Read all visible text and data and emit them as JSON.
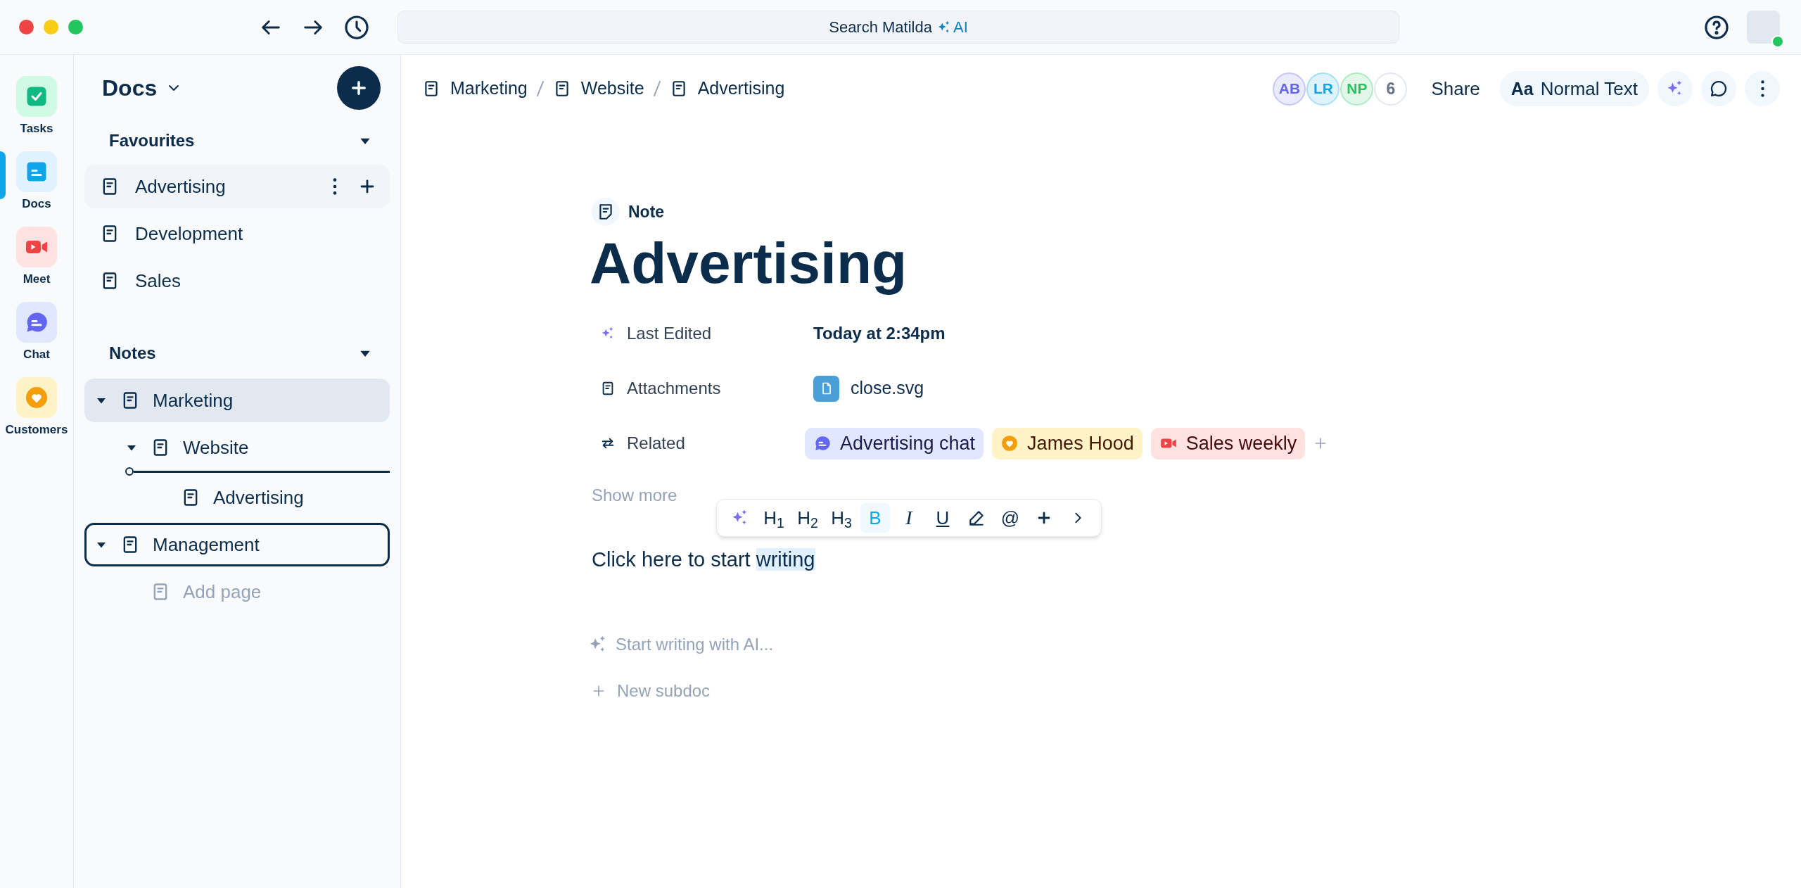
{
  "top_bar": {
    "search": {
      "text": "Search Matilda",
      "badge": "AI"
    }
  },
  "rail": [
    {
      "label": "Tasks",
      "kind": "tasks",
      "selected": false
    },
    {
      "label": "Docs",
      "kind": "docs",
      "selected": true
    },
    {
      "label": "Meet",
      "kind": "meet",
      "selected": false
    },
    {
      "label": "Chat",
      "kind": "chat",
      "selected": false
    },
    {
      "label": "Customers",
      "kind": "customers",
      "selected": false
    }
  ],
  "sidebar": {
    "title": "Docs",
    "favourites": {
      "title": "Favourites",
      "expanded": true,
      "items": [
        {
          "label": "Advertising",
          "hovered": true
        },
        {
          "label": "Development",
          "hovered": false
        },
        {
          "label": "Sales",
          "hovered": false
        }
      ]
    },
    "notes": {
      "title": "Notes",
      "expanded": true,
      "items": [
        {
          "label": "Marketing",
          "kind": "page",
          "selected": true,
          "focused": false,
          "expanded": true,
          "children": [
            {
              "label": "Website",
              "kind": "page",
              "selected": false,
              "focused": false,
              "expanded": true,
              "children": [
                {
                  "label": "Advertising",
                  "kind": "page",
                  "selected": false,
                  "focused": false,
                  "drop_target": true
                }
              ]
            }
          ]
        },
        {
          "label": "Management",
          "kind": "page",
          "selected": false,
          "focused": true,
          "expanded": true,
          "children": [
            {
              "label": "Add page",
              "kind": "add",
              "selected": false,
              "focused": false
            }
          ]
        }
      ]
    }
  },
  "header": {
    "breadcrumb": [
      "Marketing",
      "Website",
      "Advertising"
    ],
    "collaborators": [
      {
        "initials": "AB",
        "color": "#6366f1"
      },
      {
        "initials": "LR",
        "color": "#0ea5e9"
      },
      {
        "initials": "NP",
        "color": "#22c55e"
      }
    ],
    "more_count": "6",
    "share": "Share",
    "text_style_icon": "Aa",
    "text_style": "Normal Text"
  },
  "doc": {
    "type_label": "Note",
    "title": "Advertising",
    "properties": [
      {
        "label": "Last Edited",
        "kind": "date",
        "value": "Today at 2:34pm"
      },
      {
        "label": "Attachments",
        "kind": "attachment",
        "value": "close.svg"
      },
      {
        "label": "Related",
        "kind": "related",
        "chips": [
          {
            "label": "Advertising chat",
            "kind": "chat",
            "color": "#6366f1"
          },
          {
            "label": "James Hood",
            "kind": "customer",
            "color": "#f59e0b"
          },
          {
            "label": "Sales weekly",
            "kind": "meeting",
            "color": "#ef4444"
          }
        ]
      }
    ],
    "show_more": "Show more",
    "toolbar": [
      {
        "kind": "ai",
        "active": false
      },
      {
        "kind": "text",
        "label": "H$_{1}$",
        "active": false
      },
      {
        "kind": "text",
        "label": "H$_{2}$",
        "active": false
      },
      {
        "kind": "text",
        "label": "H$_{3}$",
        "active": false
      },
      {
        "kind": "text",
        "label": "B",
        "active": true
      },
      {
        "kind": "italic",
        "label": "I",
        "active": false
      },
      {
        "kind": "underline",
        "label": "U",
        "active": false
      },
      {
        "kind": "highlight",
        "active": false
      },
      {
        "kind": "text",
        "label": "@",
        "active": false
      },
      {
        "kind": "plus",
        "active": false
      },
      {
        "kind": "more",
        "active": false
      }
    ],
    "body": {
      "text": "Click here to start ",
      "selection": "writing"
    },
    "ai_prompt": "Start writing with AI...",
    "new_subdoc": "New subdoc"
  }
}
